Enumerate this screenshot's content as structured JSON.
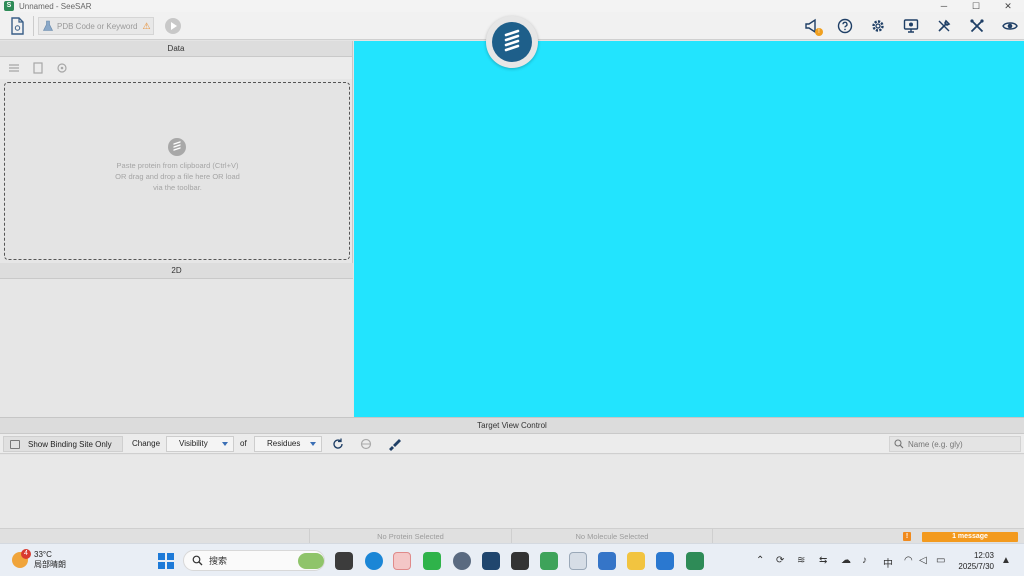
{
  "window": {
    "title": "Unnamed - SeeSAR",
    "logo_letter": "S",
    "minimize": "─",
    "maximize": "☐",
    "close": "✕"
  },
  "toolbar": {
    "pdb_placeholder": "PDB Code or Keyword",
    "pdb_warning": "⚠",
    "right_icons": [
      "megaphone-icon",
      "help-icon",
      "settings-gear-icon",
      "monitor-icon",
      "tools-icon",
      "crossed-tools-icon",
      "eye-icon"
    ],
    "notification_badge": "!"
  },
  "colors": {
    "viewer_background": "#22e4fe",
    "accent": "#1e5f8a",
    "message_badge": "#f39a1e"
  },
  "data_panel": {
    "header": "Data",
    "dropzone_text": "Paste protein from clipboard (Ctrl+V) OR drag and drop a file here OR load via the toolbar."
  },
  "panel_2d": {
    "header": "2D"
  },
  "target_view_control": {
    "header": "Target View Control",
    "show_binding_site": "Show Binding Site Only",
    "change_label": "Change",
    "property_value": "Visibility",
    "of_label": "of",
    "scope_value": "Residues",
    "search_placeholder": "Name (e.g. gly)"
  },
  "statusbar": {
    "protein": "No Protein Selected",
    "molecule": "No Molecule Selected",
    "warn_icon": "!",
    "messages": "1 message"
  },
  "taskbar": {
    "weather_badge": "4",
    "temperature": "33°C",
    "weather_desc": "局部晴朗",
    "search_label": "搜索",
    "ime": "中",
    "time": "12:03",
    "date": "2025/7/30"
  }
}
